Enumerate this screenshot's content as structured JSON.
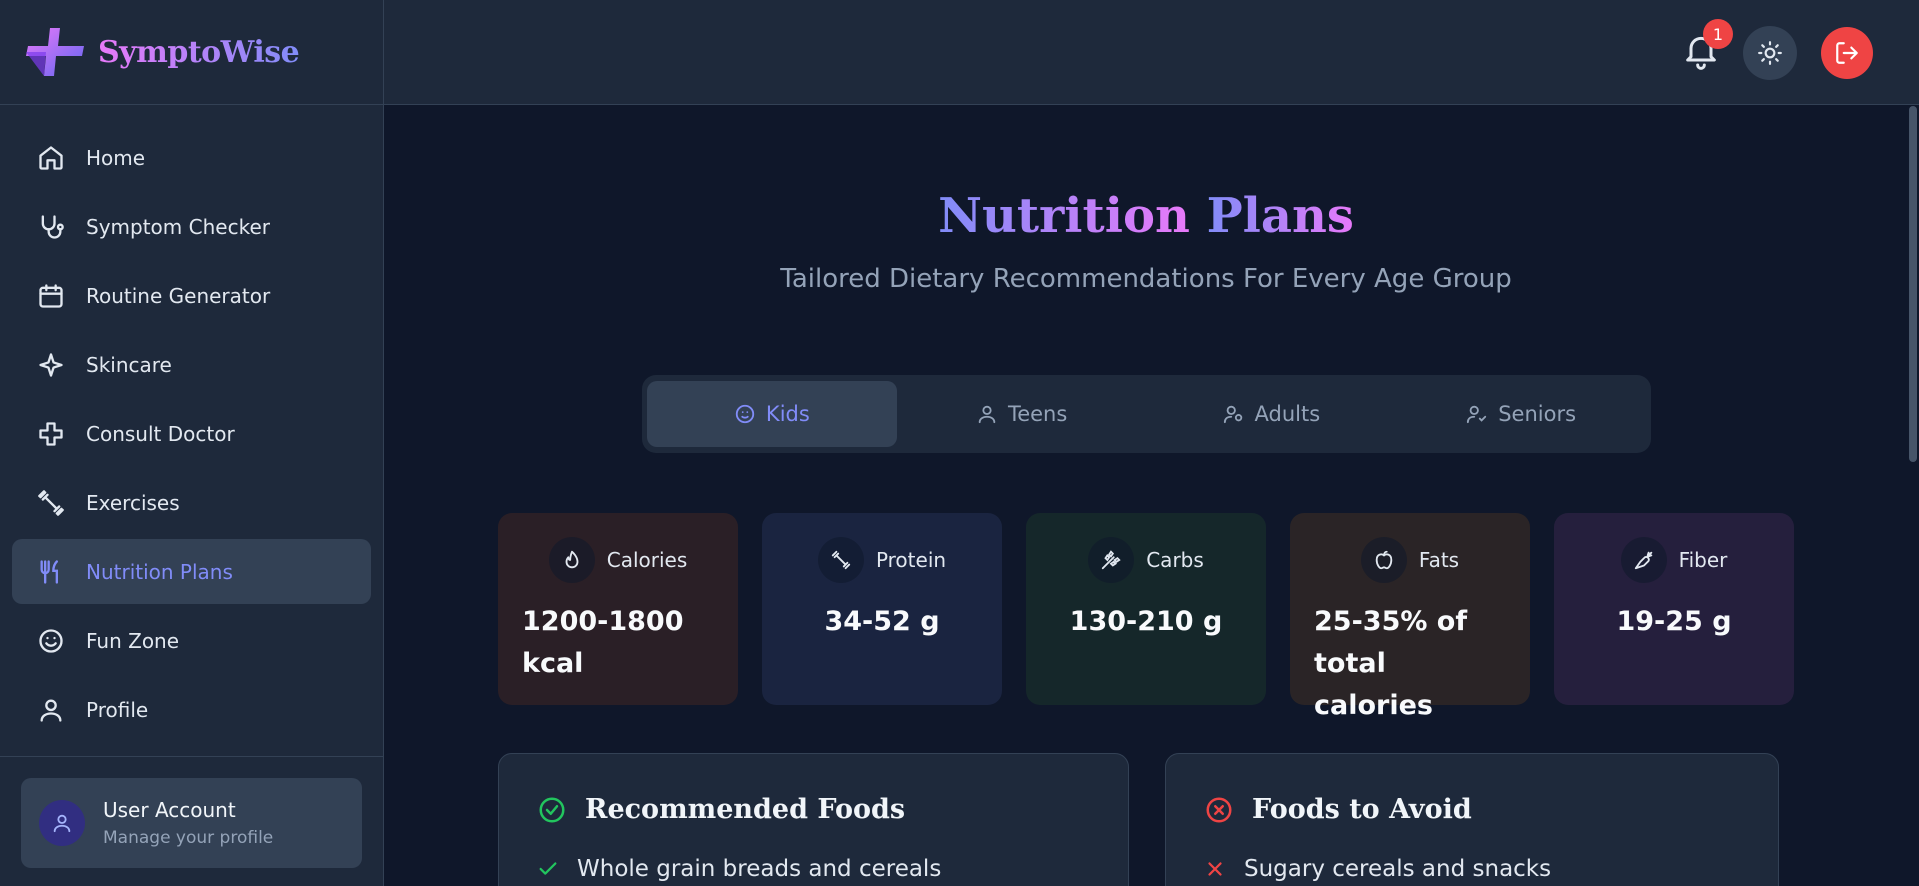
{
  "brand": {
    "name": "SymptoWise"
  },
  "sidebar": {
    "items": [
      {
        "label": "Home",
        "icon": "home-icon"
      },
      {
        "label": "Symptom Checker",
        "icon": "stethoscope-icon"
      },
      {
        "label": "Routine Generator",
        "icon": "calendar-icon"
      },
      {
        "label": "Skincare",
        "icon": "sparkle-icon"
      },
      {
        "label": "Consult Doctor",
        "icon": "medical-cross-icon"
      },
      {
        "label": "Exercises",
        "icon": "dumbbell-icon"
      },
      {
        "label": "Nutrition Plans",
        "icon": "utensils-icon",
        "active": true
      },
      {
        "label": "Fun Zone",
        "icon": "smile-icon"
      },
      {
        "label": "Profile",
        "icon": "user-icon"
      }
    ],
    "account": {
      "title": "User Account",
      "subtitle": "Manage your profile"
    }
  },
  "topbar": {
    "notification_count": "1"
  },
  "main": {
    "title_part1": "Nutrition",
    "title_part2": "Plans",
    "subtitle": "Tailored Dietary Recommendations For Every Age Group",
    "tabs": [
      {
        "label": "Kids",
        "icon": "baby-icon",
        "active": true
      },
      {
        "label": "Teens",
        "icon": "user-icon"
      },
      {
        "label": "Adults",
        "icon": "users-icon"
      },
      {
        "label": "Seniors",
        "icon": "user-check-icon"
      }
    ],
    "stats": [
      {
        "label": "Calories",
        "value": "1200-1800 kcal",
        "icon": "flame-icon"
      },
      {
        "label": "Protein",
        "value": "34-52 g",
        "icon": "dumbbell-icon"
      },
      {
        "label": "Carbs",
        "value": "130-210 g",
        "icon": "wheat-icon"
      },
      {
        "label": "Fats",
        "value": "25-35% of total calories",
        "icon": "apple-icon"
      },
      {
        "label": "Fiber",
        "value": "19-25 g",
        "icon": "carrot-icon"
      }
    ],
    "recommended": {
      "title": "Recommended Foods",
      "items": [
        "Whole grain breads and cereals"
      ]
    },
    "avoid": {
      "title": "Foods to Avoid",
      "items": [
        "Sugary cereals and snacks"
      ]
    }
  },
  "colors": {
    "accent": "#818cf8",
    "accent_pink": "#e879f9",
    "danger": "#ef4444",
    "success": "#22c55e",
    "sidebar_bg": "#1e293b",
    "main_bg": "#0f172a"
  }
}
